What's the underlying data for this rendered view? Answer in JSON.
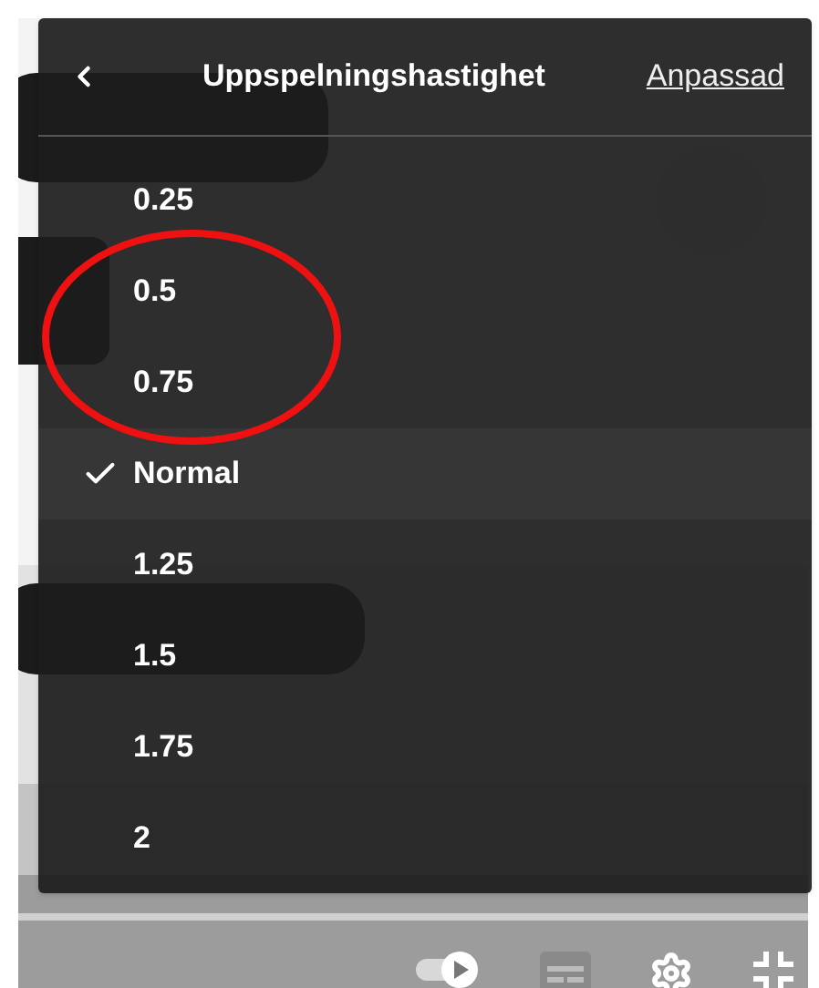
{
  "menu": {
    "title": "Uppspelningshastighet",
    "custom_link": "Anpassad",
    "options": [
      {
        "label": "0.25",
        "selected": false
      },
      {
        "label": "0.5",
        "selected": false
      },
      {
        "label": "0.75",
        "selected": false
      },
      {
        "label": "Normal",
        "selected": true
      },
      {
        "label": "1.25",
        "selected": false
      },
      {
        "label": "1.5",
        "selected": false
      },
      {
        "label": "1.75",
        "selected": false
      },
      {
        "label": "2",
        "selected": false
      }
    ]
  }
}
